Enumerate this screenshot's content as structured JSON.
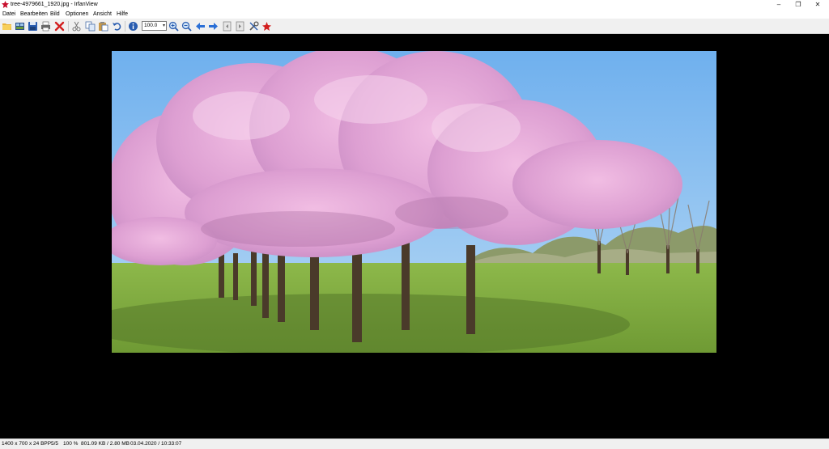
{
  "window": {
    "title": "tree-4979661_1920.jpg - IrfanView",
    "minimize_glyph": "–",
    "restore_glyph": "❐",
    "close_glyph": "✕"
  },
  "menu": {
    "items": [
      "Datei",
      "Bearbeiten",
      "Bild",
      "Optionen",
      "Ansicht",
      "Hilfe"
    ]
  },
  "toolbar": {
    "buttons": [
      "open-folder-icon",
      "thumbnails-icon",
      "save-icon",
      "print-icon",
      "delete-icon",
      "cut-icon",
      "copy-icon",
      "paste-icon",
      "undo-icon",
      "info-icon",
      "zoom-in-icon",
      "zoom-out-icon",
      "previous-icon",
      "next-icon",
      "first-page-icon",
      "last-page-icon",
      "settings-icon",
      "irfanview-icon"
    ],
    "zoom_value": "100.0"
  },
  "image": {
    "description_icon": "photo-cherry-blossom-trees"
  },
  "status": {
    "dimensions": "1400 x 700 x 24 BPP",
    "index": "5/5",
    "zoom": "100 %",
    "filesize": "801.09 KB / 2.80 MB",
    "datetime": "03.04.2020 / 10:33:07"
  },
  "colors": {
    "canvas_bg": "#000000",
    "toolbar_bg": "#f0f0f0",
    "sky": "#8fc4f2",
    "blossom": "#e3a6d4",
    "grass": "#7faa3e"
  }
}
